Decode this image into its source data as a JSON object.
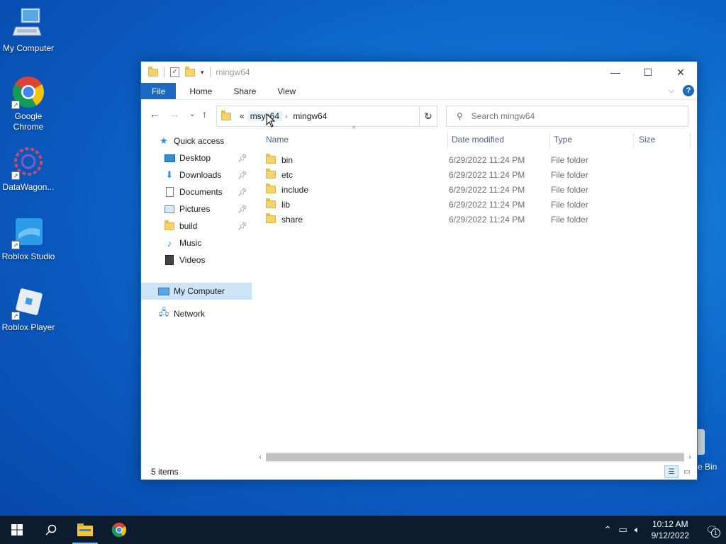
{
  "desktop": {
    "icons": [
      {
        "label": "My Computer",
        "icon": "computer-icon"
      },
      {
        "label": "Google Chrome",
        "icon": "chrome-icon"
      },
      {
        "label": "DataWagon...",
        "icon": "datawagon-icon"
      },
      {
        "label": "Roblox Studio",
        "icon": "roblox-studio-icon"
      },
      {
        "label": "Roblox Player",
        "icon": "roblox-player-icon"
      }
    ],
    "recycle_bin_partial_label": "e Bin"
  },
  "window": {
    "title": "mingw64",
    "ribbon_tabs": [
      "File",
      "Home",
      "Share",
      "View"
    ],
    "help_label": "?",
    "address": {
      "overflow": "«",
      "segments": [
        "msys64",
        "mingw64"
      ]
    },
    "search_placeholder": "Search mingw64",
    "nav_pane": {
      "quick_access": "Quick access",
      "items": [
        {
          "label": "Desktop",
          "icon": "desktop-icon",
          "pinned": true
        },
        {
          "label": "Downloads",
          "icon": "download-icon",
          "pinned": true
        },
        {
          "label": "Documents",
          "icon": "documents-icon",
          "pinned": true
        },
        {
          "label": "Pictures",
          "icon": "pictures-icon",
          "pinned": true
        },
        {
          "label": "build",
          "icon": "folder-icon",
          "pinned": true
        },
        {
          "label": "Music",
          "icon": "music-icon",
          "pinned": false
        },
        {
          "label": "Videos",
          "icon": "videos-icon",
          "pinned": false
        }
      ],
      "my_computer": "My Computer",
      "network": "Network"
    },
    "columns": [
      "Name",
      "Date modified",
      "Type",
      "Size"
    ],
    "files": [
      {
        "name": "bin",
        "date": "6/29/2022 11:24 PM",
        "type": "File folder"
      },
      {
        "name": "etc",
        "date": "6/29/2022 11:24 PM",
        "type": "File folder"
      },
      {
        "name": "include",
        "date": "6/29/2022 11:24 PM",
        "type": "File folder"
      },
      {
        "name": "lib",
        "date": "6/29/2022 11:24 PM",
        "type": "File folder"
      },
      {
        "name": "share",
        "date": "6/29/2022 11:24 PM",
        "type": "File folder"
      }
    ],
    "status": "5 items"
  },
  "taskbar": {
    "time": "10:12 AM",
    "date": "9/12/2022",
    "notification_count": "1"
  }
}
